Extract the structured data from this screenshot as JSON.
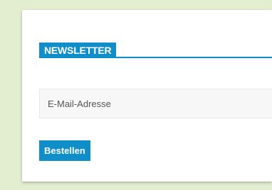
{
  "newsletter": {
    "title": "NEWSLETTER",
    "email_placeholder": "E-Mail-Adresse",
    "submit_label": "Bestellen"
  },
  "colors": {
    "accent": "#0f8ec9",
    "page_background": "#e3eed1",
    "card_background": "#ffffff",
    "field_background": "#f7f7f7"
  }
}
